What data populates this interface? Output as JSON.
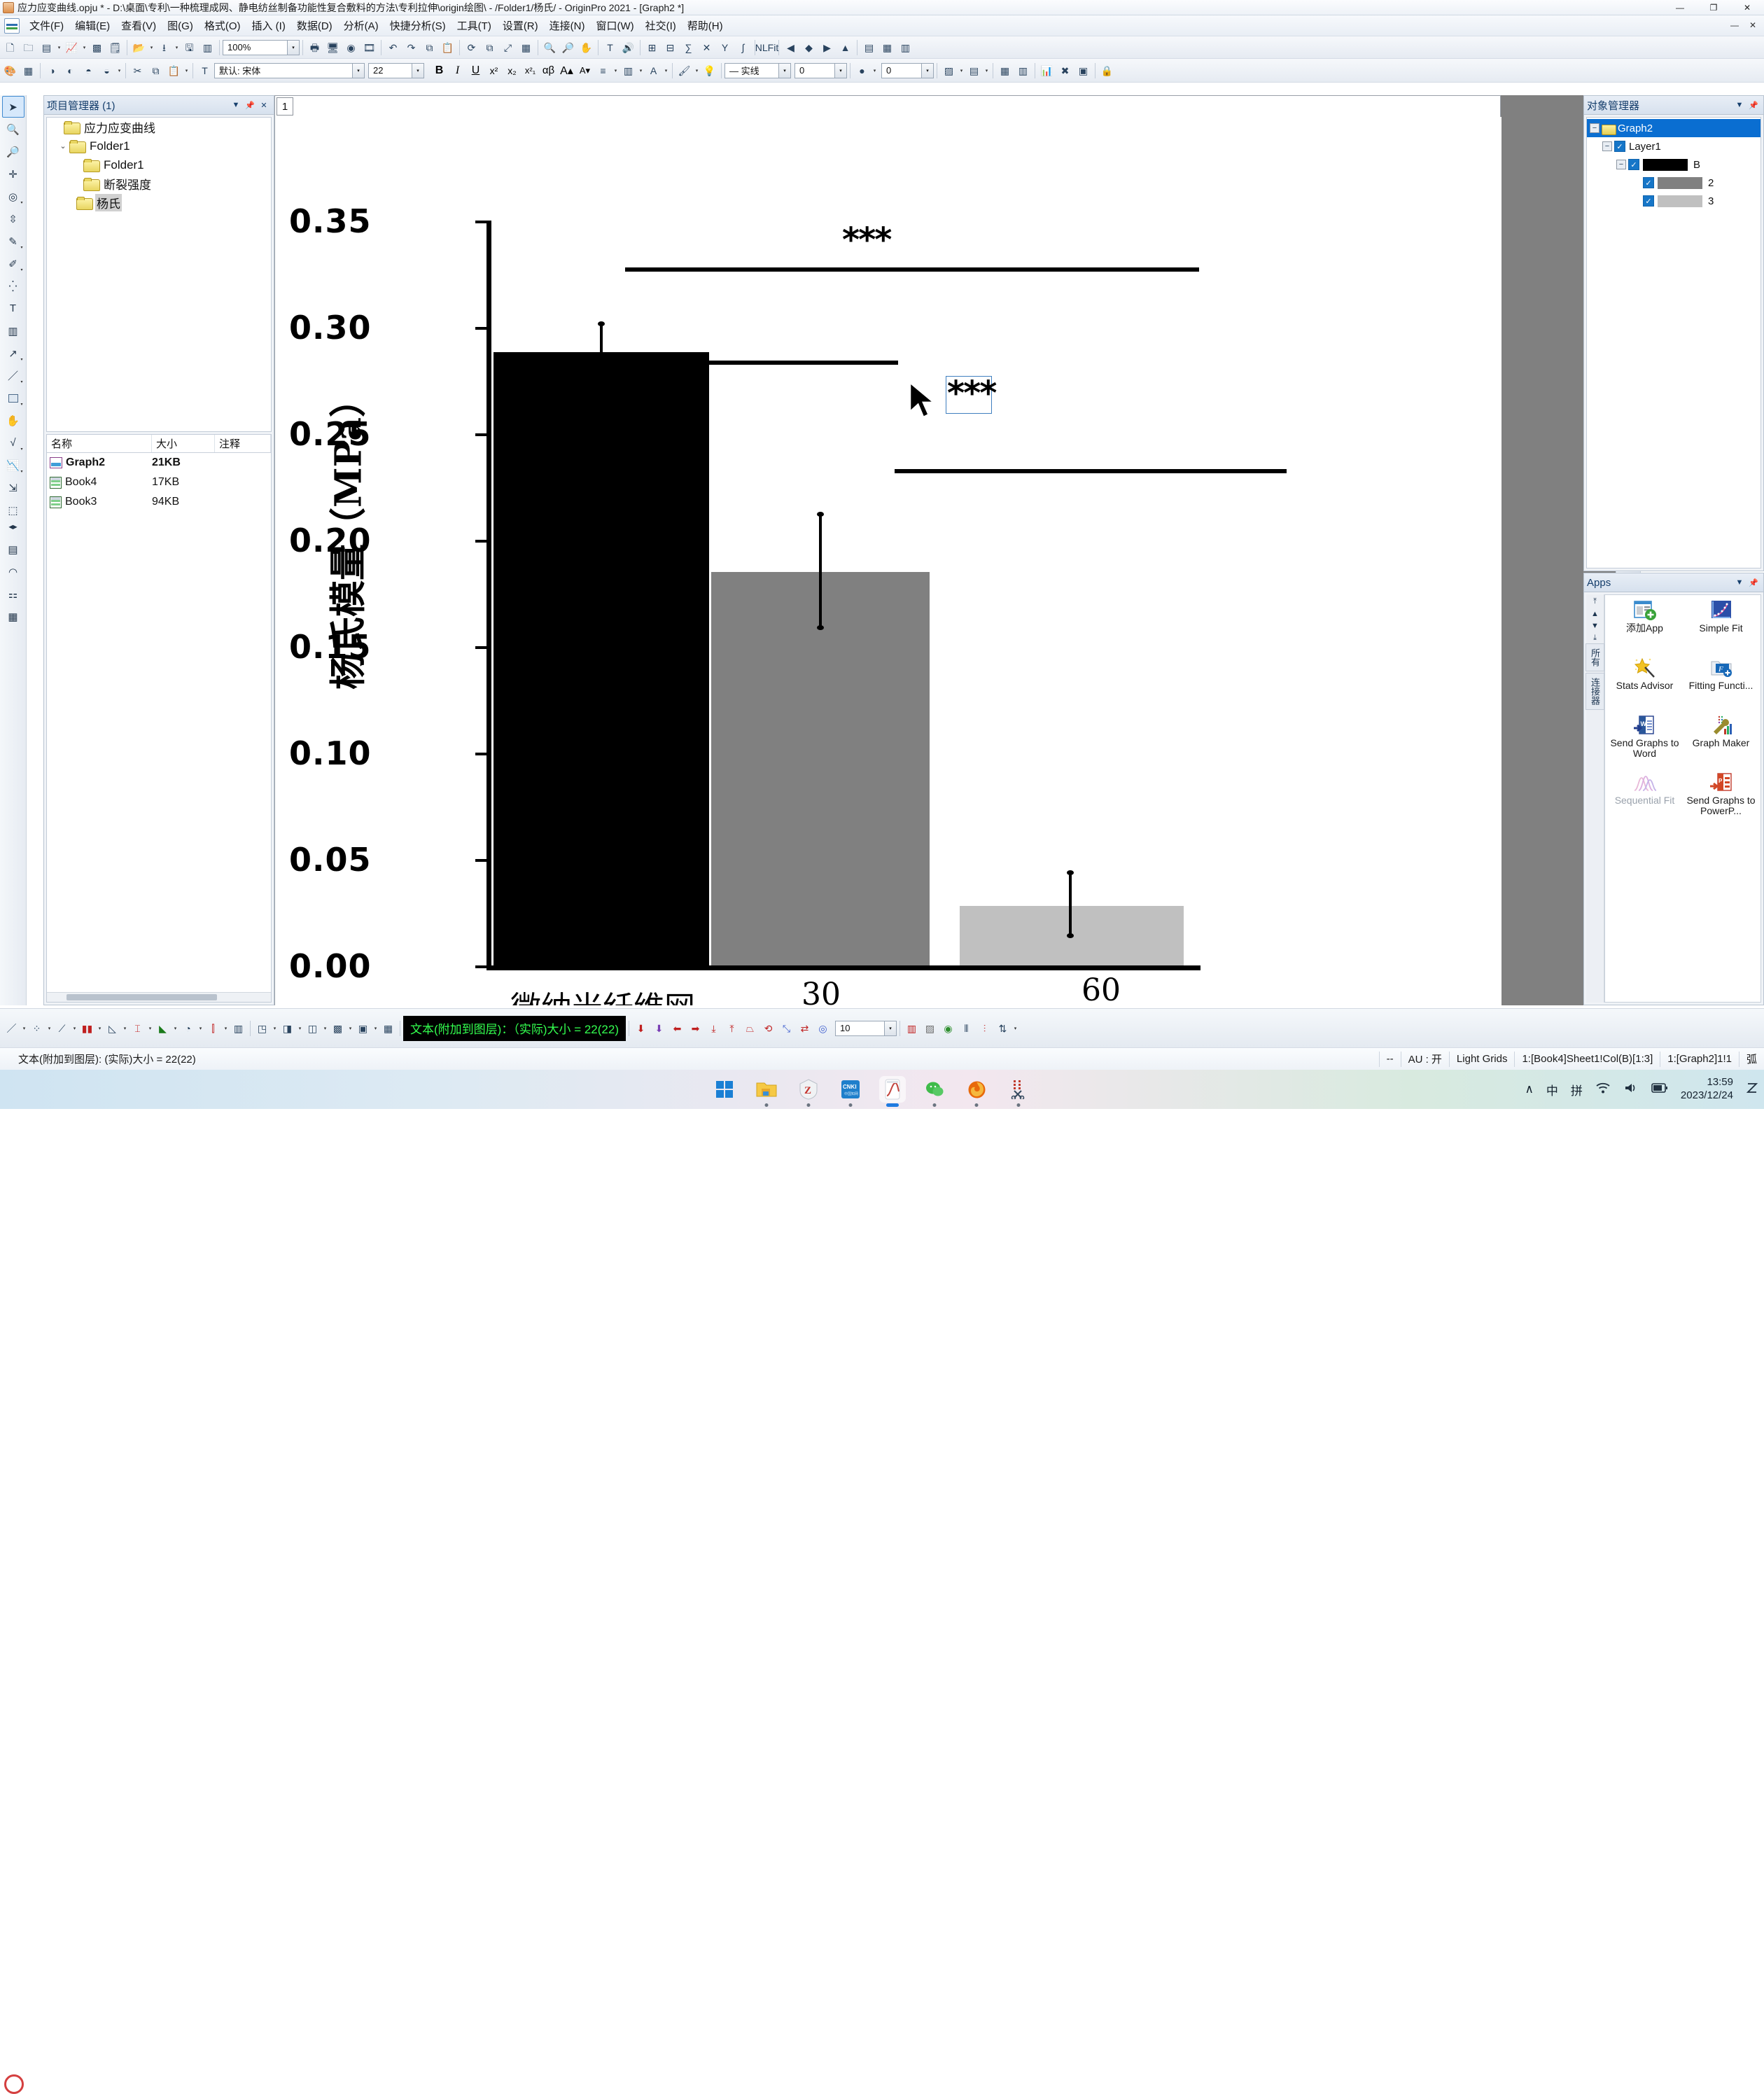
{
  "window": {
    "title": "应力应变曲线.opju * - D:\\桌面\\专利\\一种梳理成网、静电纺丝制备功能性复合敷料的方法\\专利拉伸\\origin绘图\\ - /Folder1/杨氏/ - OriginPro 2021 - [Graph2 *]",
    "minimize": "—",
    "maximize": "❐",
    "close": "✕"
  },
  "menu": {
    "items": [
      "文件(F)",
      "编辑(E)",
      "查看(V)",
      "图(G)",
      "格式(O)",
      "插入 (I)",
      "数据(D)",
      "分析(A)",
      "快捷分析(S)",
      "工具(T)",
      "设置(R)",
      "连接(N)",
      "窗口(W)",
      "社交(I)",
      "帮助(H)"
    ],
    "right_buttons": [
      "—",
      "✕"
    ]
  },
  "toolbar": {
    "zoom_value": "100%",
    "font_name": "默认: 宋体",
    "font_size": "22",
    "line_style": "— 实线",
    "line_width": "0",
    "fill_value": "0"
  },
  "project_manager": {
    "title": "项目管理器 (1)",
    "buttons": [
      "▼",
      "📌",
      "✕"
    ],
    "tree": [
      {
        "label": "应力应变曲线",
        "depth": 0,
        "expander": "",
        "selected": false
      },
      {
        "label": "Folder1",
        "depth": 1,
        "expander": "⌄",
        "selected": false
      },
      {
        "label": "Folder1",
        "depth": 2,
        "expander": "",
        "selected": false
      },
      {
        "label": "断裂强度",
        "depth": 2,
        "expander": "",
        "selected": false
      },
      {
        "label": "杨氏",
        "depth": 2,
        "expander": "",
        "selected": true
      }
    ],
    "list_headers": [
      "名称",
      "大小",
      "注释"
    ],
    "rows": [
      {
        "name": "Graph2",
        "size": "21KB",
        "comment": "",
        "icon": "graph-icon",
        "bold": true
      },
      {
        "name": "Book4",
        "size": "17KB",
        "comment": "",
        "icon": "workbook-icon",
        "bold": false
      },
      {
        "name": "Book3",
        "size": "94KB",
        "comment": "",
        "icon": "workbook-icon",
        "bold": false
      }
    ]
  },
  "graph_window": {
    "tab_label": "1"
  },
  "chart_data": {
    "type": "bar",
    "title": "",
    "xlabel": "",
    "ylabel": "杨氏模量（MPa）",
    "categories": [
      "微纳米纤维网",
      "30",
      "60"
    ],
    "values": [
      0.288,
      0.185,
      0.028
    ],
    "errors": [
      0.012,
      0.023,
      0.012
    ],
    "bar_colors": [
      "#000000",
      "#808080",
      "#c0c0c0"
    ],
    "ylim": [
      0.0,
      0.375
    ],
    "yticks": [
      "0.00",
      "0.05",
      "0.10",
      "0.15",
      "0.20",
      "0.25",
      "0.30",
      "0.35"
    ],
    "ytick_values": [
      0.0,
      0.05,
      0.1,
      0.15,
      0.2,
      0.25,
      0.3,
      0.35
    ],
    "grid": false,
    "legend": "none",
    "annotations": [
      {
        "text": "***",
        "kind": "significance-label",
        "group": "1-vs-3"
      },
      {
        "text": "***",
        "kind": "significance-label",
        "group": "2-vs-3",
        "selected": true
      }
    ],
    "significance_bars": [
      {
        "from": "微纳米纤维网",
        "to": "60",
        "y": 0.345
      },
      {
        "from": "微纳米纤维网",
        "to": "30",
        "y": 0.307
      },
      {
        "from": "30",
        "to": "60",
        "y": 0.245
      }
    ]
  },
  "object_manager": {
    "title": "对象管理器",
    "buttons": [
      "▼",
      "📌"
    ],
    "nodes": [
      {
        "label": "Graph2",
        "type": "graph",
        "selected": true,
        "checked": null,
        "swatch": null
      },
      {
        "label": "Layer1",
        "type": "layer",
        "selected": false,
        "checked": true,
        "swatch": null
      },
      {
        "label": "B",
        "type": "plot",
        "selected": false,
        "checked": true,
        "swatch": "#000000"
      },
      {
        "label": "2",
        "type": "plot",
        "selected": false,
        "checked": true,
        "swatch": "#808080"
      },
      {
        "label": "3",
        "type": "plot",
        "selected": false,
        "checked": true,
        "swatch": "#c0c0c0"
      }
    ]
  },
  "apps_panel": {
    "title": "Apps",
    "buttons": [
      "▼",
      "📌"
    ],
    "side_tabs": [
      "所有",
      "连接器"
    ],
    "items": [
      {
        "label": "添加App",
        "icon": "add-app-icon",
        "dim": false
      },
      {
        "label": "Simple Fit",
        "icon": "simple-fit-icon",
        "dim": false
      },
      {
        "label": "Stats Advisor",
        "icon": "stats-advisor-icon",
        "dim": false
      },
      {
        "label": "Fitting Functi...",
        "icon": "fitting-function-icon",
        "dim": false
      },
      {
        "label": "Send Graphs to Word",
        "icon": "send-to-word-icon",
        "dim": false
      },
      {
        "label": "Graph Maker",
        "icon": "graph-maker-icon",
        "dim": false
      },
      {
        "label": "Sequential Fit",
        "icon": "sequential-fit-icon",
        "dim": true
      },
      {
        "label": "Send Graphs to PowerP...",
        "icon": "send-to-powerpoint-icon",
        "dim": false
      }
    ]
  },
  "bottom_toolbar": {
    "message": "文本(附加到图层)：（实际)大小 = 22(22)",
    "spin_value": "10"
  },
  "status_bar": {
    "message": "文本(附加到图层): (实际)大小 = 22(22)",
    "cells": [
      "--",
      "AU : 开",
      "Light Grids",
      "1:[Book4]Sheet1!Col(B)[1:3]",
      "1:[Graph2]1!1",
      "弧"
    ]
  },
  "taskbar": {
    "apps": [
      {
        "name": "start-button",
        "active": false
      },
      {
        "name": "file-explorer",
        "active": false
      },
      {
        "name": "zotero",
        "active": false
      },
      {
        "name": "cnki-app",
        "active": false
      },
      {
        "name": "origin-app",
        "active": true
      },
      {
        "name": "wechat-app",
        "active": false
      },
      {
        "name": "firefox-app",
        "active": false
      },
      {
        "name": "snipping-tool",
        "active": false
      }
    ],
    "tray": [
      "∧",
      "中",
      "拼",
      "wifi-icon",
      "volume-icon",
      "battery-icon"
    ],
    "time": "13:59",
    "date": "2023/12/24"
  }
}
